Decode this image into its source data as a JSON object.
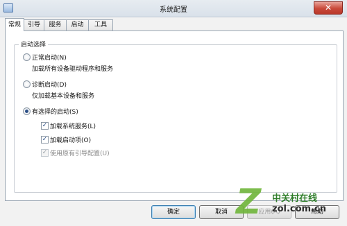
{
  "window": {
    "title": "系统配置",
    "close_glyph": "✕",
    "icon": "app-window-icon"
  },
  "tabs": [
    {
      "label": "常规",
      "active": true
    },
    {
      "label": "引导",
      "active": false
    },
    {
      "label": "服务",
      "active": false
    },
    {
      "label": "启动",
      "active": false
    },
    {
      "label": "工具",
      "active": false
    }
  ],
  "startup": {
    "group_label": "启动选择",
    "normal": {
      "label": "正常启动(N)",
      "desc": "加载所有设备驱动程序和服务",
      "checked": false
    },
    "diagnostic": {
      "label": "诊断启动(D)",
      "desc": "仅加载基本设备和服务",
      "checked": false
    },
    "selective": {
      "label": "有选择的启动(S)",
      "checked": true,
      "options": [
        {
          "label": "加载系统服务(L)",
          "checked": true,
          "enabled": true
        },
        {
          "label": "加载启动项(O)",
          "checked": true,
          "enabled": true
        },
        {
          "label": "使用原有引导配置(U)",
          "checked": true,
          "enabled": false
        }
      ]
    }
  },
  "buttons": {
    "ok": "确定",
    "cancel": "取消",
    "apply": "应用(A)",
    "help": "帮助"
  },
  "watermark": {
    "mark": "Z",
    "name": "中关村在线",
    "url": "zol.com.cn"
  }
}
